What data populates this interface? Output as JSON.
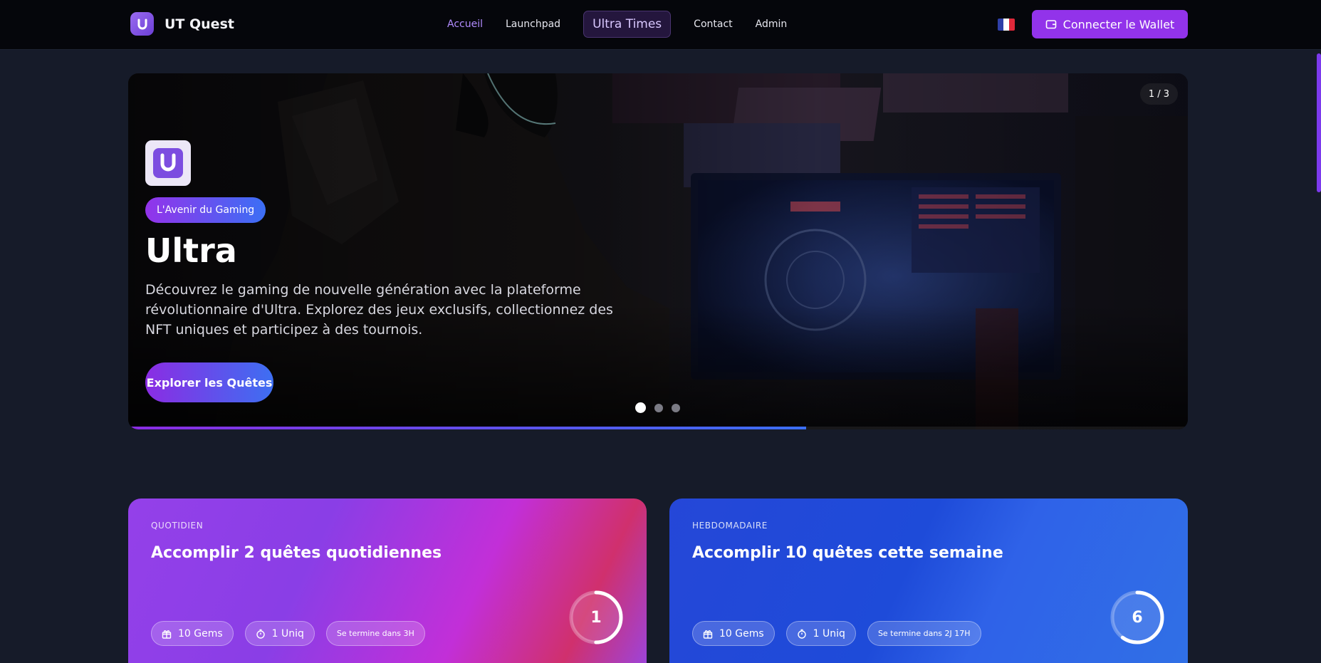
{
  "navbar": {
    "brand_name": "UT Quest",
    "links": [
      "Accueil",
      "Launchpad",
      "Ultra Times",
      "Contact",
      "Admin"
    ],
    "active_link": "Accueil",
    "wallet_button": "Connecter le Wallet",
    "language_icon": "flag-fr-icon"
  },
  "hero": {
    "slide_counter": "1 / 3",
    "badge": "L'Avenir du Gaming",
    "title": "Ultra",
    "description": "Découvrez le gaming de nouvelle génération avec la plateforme révolutionnaire d'Ultra. Explorez des jeux exclusifs, collectionnez des NFT uniques et participez à des tournois.",
    "cta": "Explorer les Quêtes",
    "active_dot": 1,
    "dot_count": 3,
    "slide_progress": 0.64
  },
  "quests": [
    {
      "label": "QUOTIDIEN",
      "title": "Accomplir 2 quêtes quotidiennes",
      "reward_gems": "10 Gems",
      "reward_uniq": "1 Uniq",
      "ends": "Se termine dans 3H",
      "progress_value": "1",
      "progress_fraction": 0.5
    },
    {
      "label": "HEBDOMADAIRE",
      "title": "Accomplir 10 quêtes cette semaine",
      "reward_gems": "10 Gems",
      "reward_uniq": "1 Uniq",
      "ends": "Se termine dans 2J 17H",
      "progress_value": "6",
      "progress_fraction": 0.6
    }
  ],
  "colors": {
    "accent_purple": "#9233ea",
    "accent_blue": "#3b6ff5",
    "page_background": "#161b29",
    "navbar_background": "#05060b"
  }
}
